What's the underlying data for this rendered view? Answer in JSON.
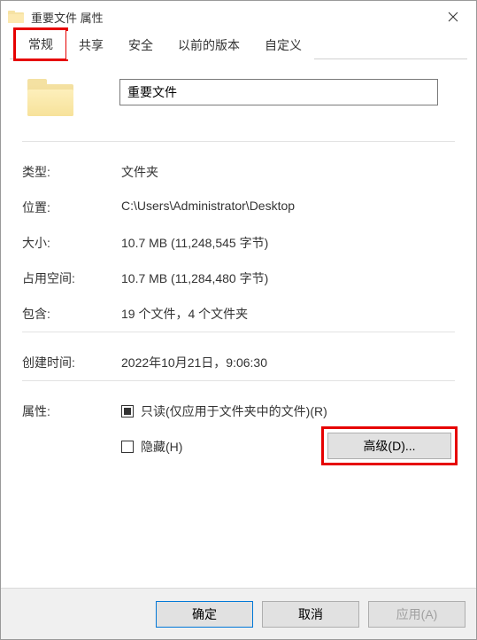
{
  "window": {
    "title": "重要文件 属性"
  },
  "tabs": {
    "general": "常规",
    "sharing": "共享",
    "security": "安全",
    "previous": "以前的版本",
    "custom": "自定义"
  },
  "name_value": "重要文件",
  "labels": {
    "type": "类型:",
    "location": "位置:",
    "size": "大小:",
    "size_on_disk": "占用空间:",
    "contains": "包含:",
    "created": "创建时间:",
    "attributes": "属性:"
  },
  "values": {
    "type": "文件夹",
    "location": "C:\\Users\\Administrator\\Desktop",
    "size": "10.7 MB (11,248,545 字节)",
    "size_on_disk": "10.7 MB (11,284,480 字节)",
    "contains": "19 个文件，4 个文件夹",
    "created": "2022年10月21日，9:06:30"
  },
  "attributes": {
    "readonly_label": "只读(仅应用于文件夹中的文件)(R)",
    "hidden_label": "隐藏(H)",
    "advanced_label": "高级(D)..."
  },
  "footer": {
    "ok": "确定",
    "cancel": "取消",
    "apply": "应用(A)"
  }
}
